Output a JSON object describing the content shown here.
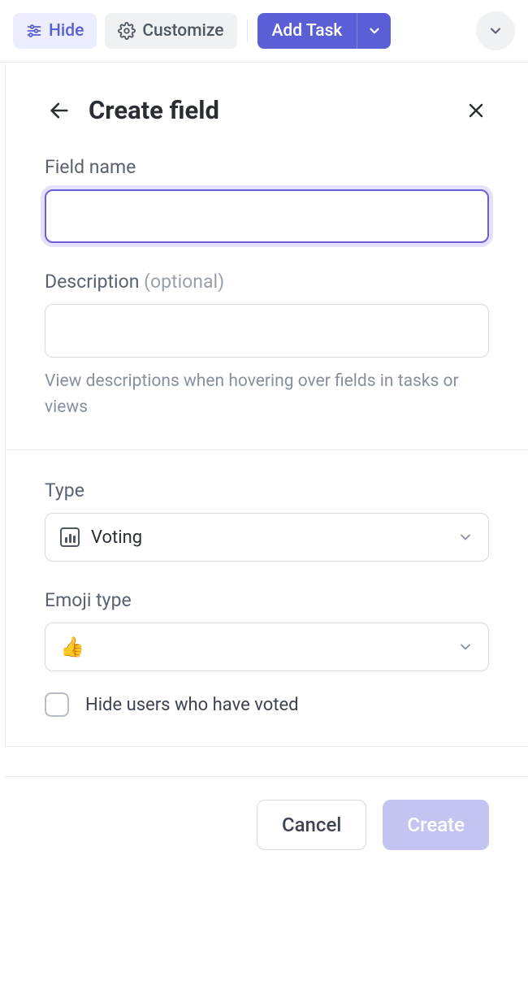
{
  "toolbar": {
    "hide_label": "Hide",
    "customize_label": "Customize",
    "add_task_label": "Add Task"
  },
  "panel": {
    "title": "Create field",
    "field_name_label": "Field name",
    "field_name_value": "",
    "description_label": "Description",
    "description_optional": "(optional)",
    "description_value": "",
    "description_helper": "View descriptions when hovering over fields in tasks or views",
    "type_label": "Type",
    "type_value": "Voting",
    "emoji_type_label": "Emoji type",
    "emoji_value": "👍",
    "hide_voters_label": "Hide users who have voted"
  },
  "footer": {
    "cancel_label": "Cancel",
    "create_label": "Create"
  }
}
